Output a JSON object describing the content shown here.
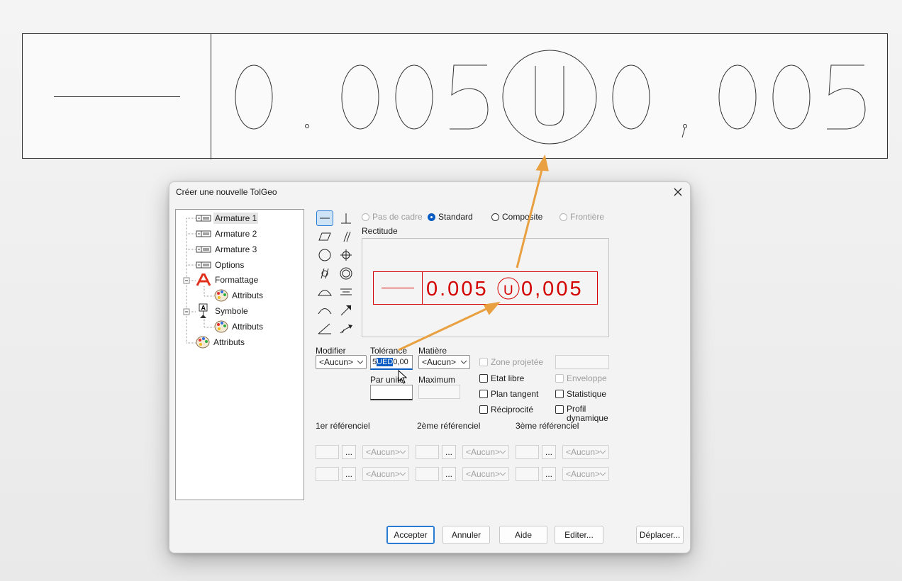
{
  "fcf": {
    "top_value": "0.005",
    "modifier": "U",
    "bottom_value": "0,005"
  },
  "dialog": {
    "title": "Créer une nouvelle TolGeo",
    "tree": [
      {
        "label": "Armature 1",
        "selected": true
      },
      {
        "label": "Armature 2"
      },
      {
        "label": "Armature 3"
      },
      {
        "label": "Options"
      },
      {
        "label": "Formattage"
      },
      {
        "label": "Attributs"
      },
      {
        "label": "Symbole"
      },
      {
        "label": "Attributs"
      },
      {
        "label": "Attributs"
      }
    ],
    "frame_options": {
      "pas_de_cadre": "Pas de cadre",
      "standard": "Standard",
      "composite": "Composite",
      "frontiere": "Frontière",
      "selected": "Standard"
    },
    "characteristic": "Rectitude",
    "preview": {
      "value1": "0.005",
      "modifier": "U",
      "value2": "0,005",
      "color": "#d40000"
    },
    "fields": {
      "modifier_label": "Modifier",
      "modifier_value": "<Aucun>",
      "tolerance_label": "Tolérance",
      "tolerance_pre": "5",
      "tolerance_sel": "UED",
      "tolerance_post": "0,00",
      "matiere_label": "Matière",
      "matiere_value": "<Aucun>",
      "par_unite_label": "Par unité",
      "maximum_label": "Maximum"
    },
    "checkboxes": {
      "zone_projetee": "Zone projetée",
      "etat_libre": "Etat libre",
      "plan_tangent": "Plan tangent",
      "reciprocite": "Réciprocité",
      "enveloppe": "Enveloppe",
      "statistique": "Statistique",
      "profil_dynamique": "Profil dynamique"
    },
    "datums": {
      "first": "1er référenciel",
      "second": "2ème référenciel",
      "third": "3ème référenciel",
      "ellipsis": "...",
      "combo_value": "<Aucun>"
    },
    "buttons": {
      "accept": "Accepter",
      "cancel": "Annuler",
      "help": "Aide",
      "edit": "Editer...",
      "move": "Déplacer..."
    }
  },
  "colors": {
    "accent": "#0a5cc2",
    "annotation_arrow": "#e8a040",
    "preview_red": "#d40000"
  }
}
